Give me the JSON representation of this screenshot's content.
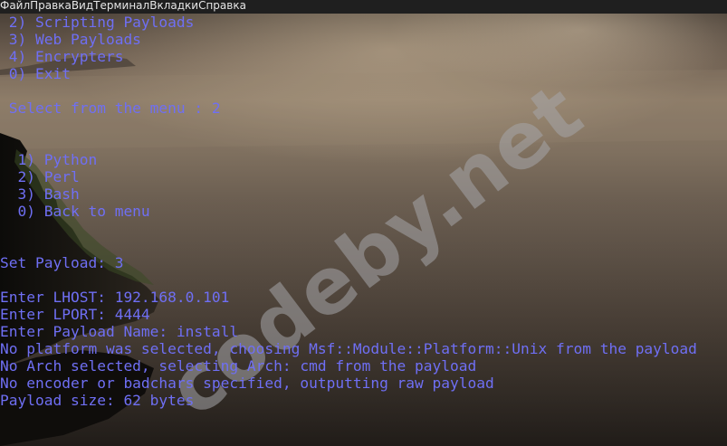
{
  "menubar": {
    "items": [
      "Файл",
      "Правка",
      "Вид",
      "Терминал",
      "Вкладки",
      "Справка"
    ]
  },
  "terminal": {
    "lines": [
      " 2) Scripting Payloads",
      " 3) Web Payloads",
      " 4) Encrypters",
      " 0) Exit",
      "",
      " Select from the menu : 2",
      "",
      "",
      "  1) Python",
      "  2) Perl",
      "  3) Bash",
      "  0) Back to menu",
      "",
      "",
      "Set Payload: 3",
      "",
      "Enter LHOST: 192.168.0.101",
      "Enter LPORT: 4444",
      "Enter Payload Name: install",
      "No platform was selected, choosing Msf::Module::Platform::Unix from the payload",
      "No Arch selected, selecting Arch: cmd from the payload",
      "No encoder or badchars specified, outputting raw payload",
      "Payload size: 62 bytes"
    ],
    "text_color": "#6f6ff4"
  },
  "watermark": {
    "text": "codeby.net"
  }
}
